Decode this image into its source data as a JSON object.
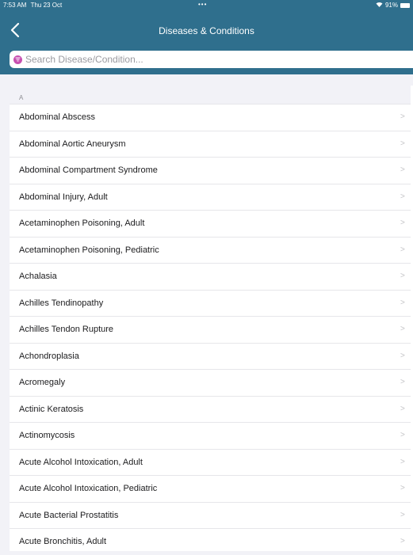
{
  "status_bar": {
    "time": "7:53 AM",
    "date": "Thu 23 Oct",
    "dots": "•••",
    "battery_percent": "91%",
    "wifi_icon": "wifi-icon",
    "battery_icon": "battery-icon"
  },
  "nav": {
    "title": "Diseases & Conditions",
    "back_icon": "chevron-left-icon"
  },
  "search": {
    "placeholder": "Search Disease/Condition...",
    "value": "",
    "icon": "search-icon"
  },
  "list": {
    "section_letter": "A",
    "items": [
      "Abdominal Abscess",
      "Abdominal Aortic Aneurysm",
      "Abdominal Compartment Syndrome",
      "Abdominal Injury, Adult",
      "Acetaminophen Poisoning, Adult",
      "Acetaminophen Poisoning, Pediatric",
      "Achalasia",
      "Achilles Tendinopathy",
      "Achilles Tendon Rupture",
      "Achondroplasia",
      "Acromegaly",
      "Actinic Keratosis",
      "Actinomycosis",
      "Acute Alcohol Intoxication, Adult",
      "Acute Alcohol Intoxication, Pediatric",
      "Acute Bacterial Prostatitis",
      "Acute Bronchitis, Adult"
    ],
    "chevron": ">"
  },
  "colors": {
    "header": "#2f6f8d",
    "background": "#f2f2f7",
    "search_icon": "#c74fb0"
  }
}
